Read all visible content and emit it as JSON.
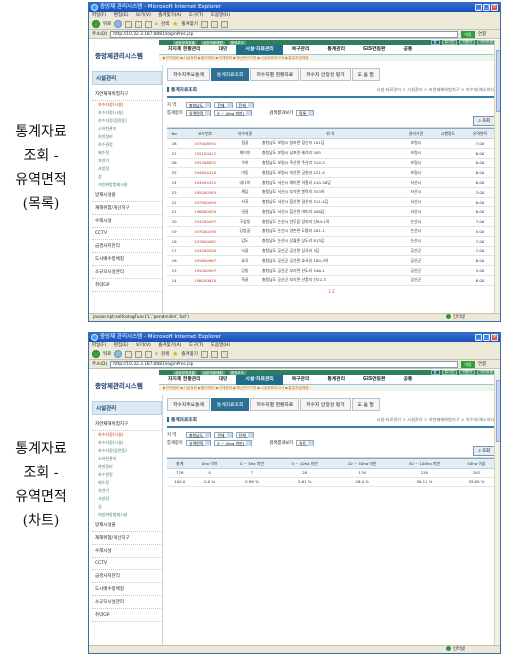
{
  "captions": {
    "list": [
      "통계자료",
      "조회 -",
      "유역면적",
      "(목록)"
    ],
    "chart": [
      "통계자료",
      "조회 -",
      "유역면적",
      "(차트)"
    ]
  },
  "browser": {
    "title": "중앙제 관리시스템 - Microsoft Internet Explorer",
    "menu": [
      "파일(F)",
      "편집(E)",
      "보기(V)",
      "즐겨찾기(A)",
      "도구(T)",
      "도움말(H)"
    ],
    "toolbar": {
      "back": "뒤로",
      "search": "검색",
      "favorites": "즐겨찾기"
    },
    "address_label": "주소(D)",
    "address_value": "http://10.32.3.187:8081/loginProc.jsp",
    "go_label": "이동",
    "links_label": "연결"
  },
  "status": {
    "shot1": "javascript:selfcologFunc('L','pendmillel','list')",
    "shot2": "",
    "zone": "인터넷"
  },
  "app": {
    "logo": "중앙제관리시스템",
    "top_pills": [
      "공공부처표출",
      "상호작용매핑",
      "원격코드"
    ],
    "util": [
      "홈",
      "로그인",
      "사용자",
      "사이트맵"
    ],
    "nav": [
      "자지제 현황관리",
      "대민",
      "시설·자료관리",
      "복구관리",
      "통계관리",
      "GIS연동환",
      "공통"
    ],
    "active_nav": 2,
    "subnav": "▶인력정비  ▶시설정비  ▶물자정비  ▶자재정비  ▶재난관리기관  ▶시설정비보고서  ▶통일처방제량"
  },
  "sidebar": {
    "title": "시설관리",
    "groups": [
      {
        "label": "자연재해위험지구",
        "subs": [
          "하수자정(시설)",
          "하수자정(시설)",
          "하수자정(읍면동)",
          "소하천관리",
          "하천정비",
          "하수관정",
          "배수정",
          "자연기",
          "사방정",
          "섬",
          "저방위방법제시설"
        ],
        "active": 0
      },
      {
        "label": "방재시설물",
        "subs": []
      },
      {
        "label": "재해위험/개선지구",
        "subs": []
      },
      {
        "label": "수해시설",
        "subs": []
      },
      {
        "label": "CCTV",
        "subs": []
      },
      {
        "label": "급경사지관리",
        "subs": []
      },
      {
        "label": "도시배수정체정",
        "subs": []
      },
      {
        "label": "소규모시설관리",
        "subs": []
      },
      {
        "label": "취약GP",
        "subs": []
      }
    ]
  },
  "content": {
    "tabs": [
      "저수지주요통계",
      "통계자료조회",
      "저수지별 현황자료",
      "저수지 안정성 평가",
      "도 움 말"
    ],
    "active_tab": 1,
    "section_title": "통계자료조회",
    "breadcrumb": "시설·자료관리 > 시설관리 > 자연재해위험지구 > 저수지(해소하다)",
    "filter": {
      "region_label": "지  역",
      "region_province": "충청남도",
      "region_city": "전체",
      "region_town": "전체",
      "category_label": "통계항목",
      "category_value": "유역면적",
      "range_value": "E ~ (0ha 미만)",
      "view_label": "검색결과보기",
      "view_list": "목록",
      "view_chart": "차트",
      "search_label": "조회"
    },
    "list_headers": [
      "No",
      "코드번호",
      "저수지명",
      "위  치",
      "관리기관",
      "시행정도",
      "유역면적"
    ],
    "list_rows": [
      [
        "28",
        "197008591",
        "점골",
        "충청남도 보령시 청라면 장산리 101답",
        "보령시",
        "",
        "7.00"
      ],
      [
        "27",
        "195100012",
        "채이미",
        "충청남도 보령시 남포면 제석리 505",
        "보령시",
        "",
        "6.00"
      ],
      [
        "26",
        "195306831",
        "우마",
        "충청남도 보령시 주산면 주산리 314-3",
        "보령시",
        "",
        "6.00"
      ],
      [
        "25",
        "194804410",
        "마동",
        "충청남도 보령시 미산면 궁현리 221-4",
        "보령시",
        "",
        "6.00"
      ],
      [
        "24",
        "194904432",
        "내나미",
        "충청남도 서산시 해미면 석흥리 410-36답",
        "서산시",
        "",
        "6.00"
      ],
      [
        "23",
        "195000363",
        "계담",
        "충청남도 서산시 부석면 봉락리 553하",
        "서산시",
        "",
        "3.00"
      ],
      [
        "22",
        "197900095",
        "사곡",
        "충청남도 서산시 읍산면 갈산리 311-4답",
        "서산시",
        "",
        "6.00"
      ],
      [
        "21",
        "196800059",
        "냇골",
        "충청남도 서산시 읍산면 여미리 408답",
        "서산시",
        "",
        "6.00"
      ],
      [
        "20",
        "154500497",
        "구상동",
        "충청남도 논산시 연무읍 양지리 산64-1하",
        "논산시",
        "",
        "7.00"
      ],
      [
        "19",
        "197000293",
        "당방골",
        "충청남도 논산시 양촌면 도평리 281-1",
        "논산시",
        "",
        "5.00"
      ],
      [
        "18",
        "197600081",
        "감도",
        "충청남도 논산시 상월면 상도리 813답",
        "논산시",
        "",
        "7.00"
      ],
      [
        "17",
        "154500500",
        "낙골",
        "충청남도 공산군 공산면 삼곡리 3답",
        "공산군",
        "",
        "7.00"
      ],
      [
        "16",
        "195600967",
        "효곡",
        "충청남도 공산군 공산면 효곡리 180-3하",
        "공산군",
        "",
        "6.00"
      ],
      [
        "15",
        "195000907",
        "당방",
        "충청남도 공산군 부리면 신도리 546-1",
        "공산군",
        "",
        "5.00"
      ],
      [
        "14",
        "198000610",
        "죽골",
        "충청남도 공산군 부리면 산풍리 산22-3",
        "공산군",
        "",
        "6.00"
      ]
    ],
    "pager": "1 2",
    "chart_headers": [
      "총계",
      "0ha 이하",
      "0 ~ 5ha 미만",
      "5 ~ 10ha 미만",
      "10 ~ 50ha 미만",
      "50 ~ 100ha 미만",
      "50ha 이상"
    ],
    "chart_rows": [
      [
        "776",
        "0",
        "7",
        "28",
        "176",
        "230",
        "292"
      ],
      [
        "100.0",
        "0.0 %",
        "0.98 %",
        "3.61 %",
        "26.0 %",
        "36.11 %",
        "39.89 %"
      ]
    ]
  }
}
